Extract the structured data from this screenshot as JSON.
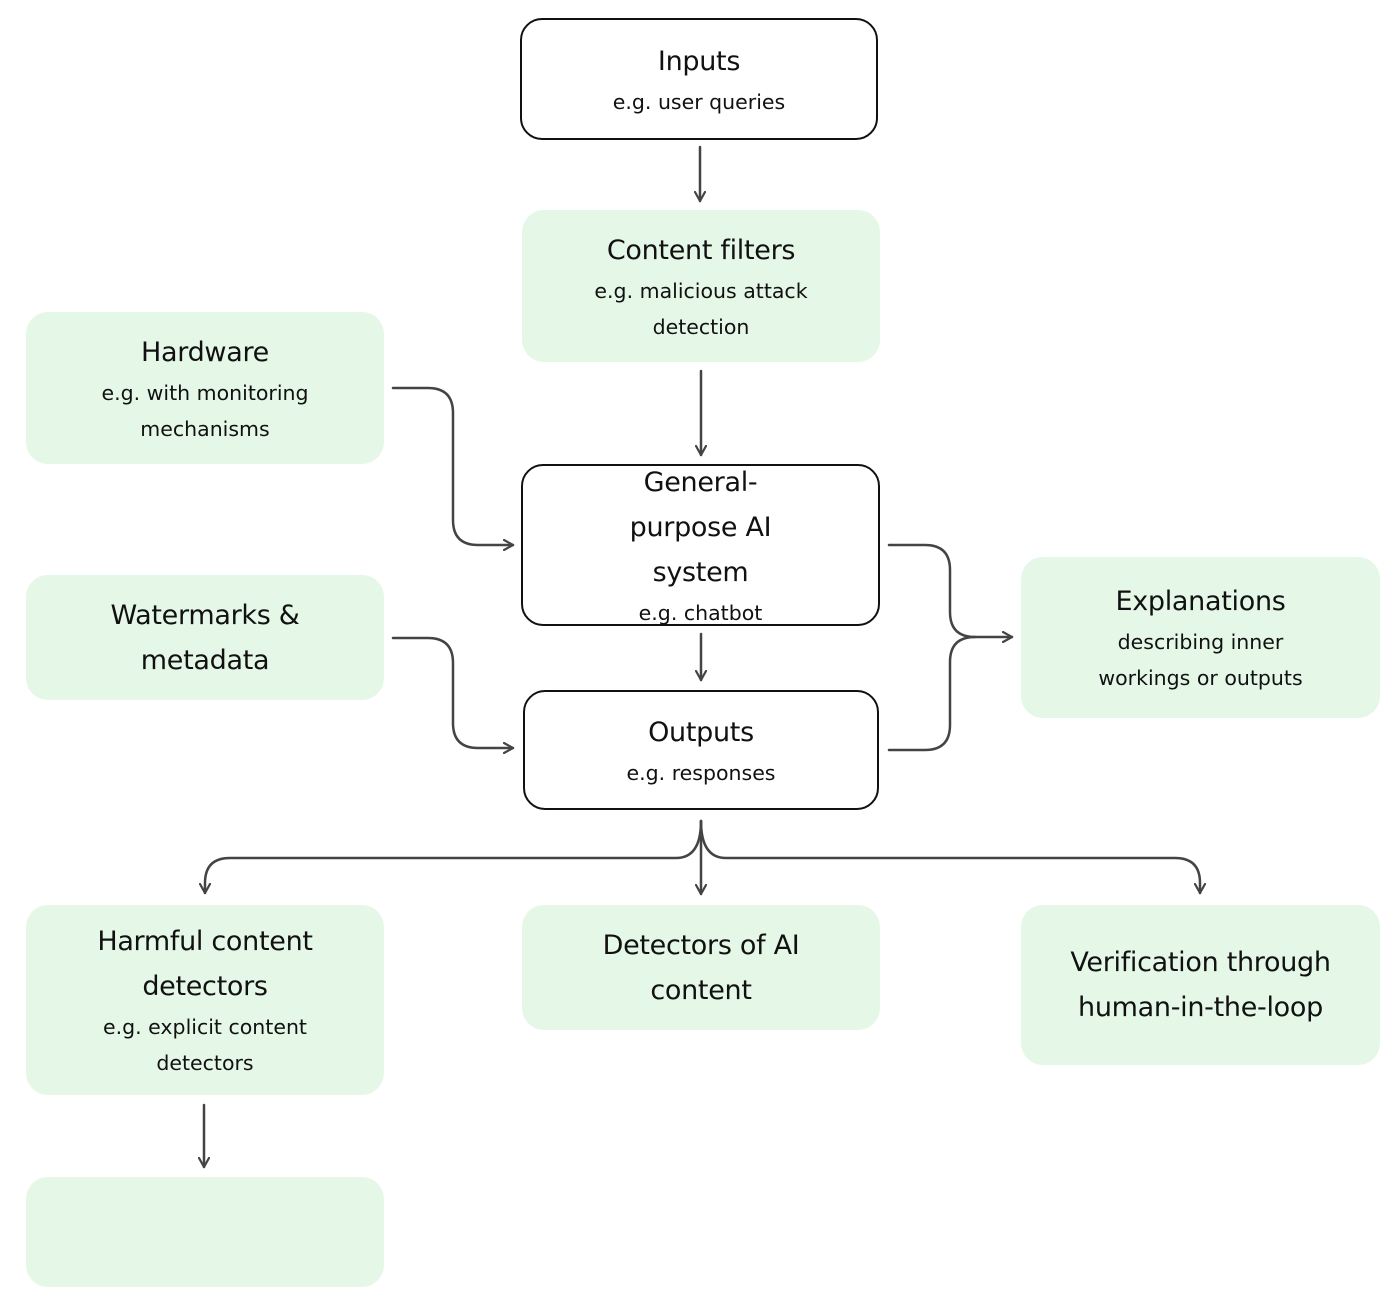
{
  "colors": {
    "node_fill": "#e5f7e6",
    "core_fill": "#ffffff",
    "core_border": "#111111",
    "arrow": "#444444"
  },
  "nodes": {
    "inputs": {
      "title": "Inputs",
      "subtitle": "e.g. user queries"
    },
    "content_filters": {
      "title": "Content filters",
      "subtitle": "e.g. malicious attack detection"
    },
    "hardware": {
      "title": "Hardware",
      "subtitle": "e.g. with monitoring mechanisms"
    },
    "gp_system": {
      "title": "General-purpose AI system",
      "subtitle": "e.g. chatbot"
    },
    "watermarks": {
      "title": "Watermarks & metadata"
    },
    "outputs": {
      "title": "Outputs",
      "subtitle": "e.g. responses"
    },
    "explanations": {
      "title": "Explanations",
      "subtitle": "describing inner workings or outputs"
    },
    "harmful": {
      "title": "Harmful content detectors",
      "subtitle": "e.g. explicit content detectors"
    },
    "detectors_ai": {
      "title": "Detectors of AI content"
    },
    "verification": {
      "title": "Verification through human-in-the-loop"
    },
    "empty": {}
  },
  "edges": [
    [
      "inputs",
      "content_filters"
    ],
    [
      "content_filters",
      "gp_system"
    ],
    [
      "hardware",
      "gp_system"
    ],
    [
      "gp_system",
      "outputs"
    ],
    [
      "watermarks",
      "outputs"
    ],
    [
      "gp_system",
      "explanations"
    ],
    [
      "outputs",
      "explanations"
    ],
    [
      "outputs",
      "harmful"
    ],
    [
      "outputs",
      "detectors_ai"
    ],
    [
      "outputs",
      "verification"
    ],
    [
      "harmful",
      "empty"
    ]
  ]
}
